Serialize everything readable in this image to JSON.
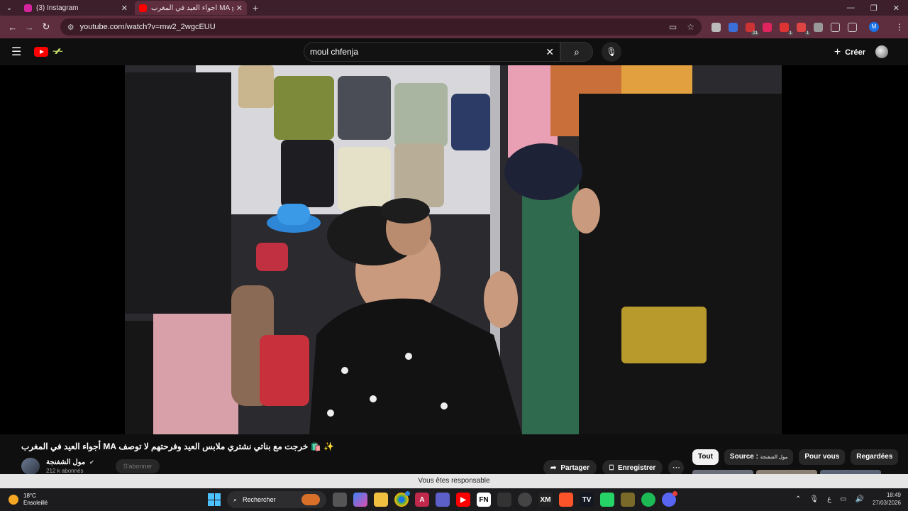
{
  "browser": {
    "tabs": [
      {
        "title": "(3) Instagram",
        "favicon_color": "#d6249f"
      },
      {
        "title": "أجواء العيد في المغرب MA خ...",
        "favicon_color": "#ff0000"
      }
    ],
    "url": "youtube.com/watch?v=mw2_2wgcEUU",
    "profile_initial": "M",
    "extension_badges": [
      "21",
      "1",
      "1"
    ]
  },
  "youtube": {
    "search_query": "moul chfenja",
    "create_label": "Créer",
    "video": {
      "title": "✨ 🛍️ خرجت مع بناتي نشتري ملابس العيد وفرحتهم لا توصف MA أجواء العيد في المغرب",
      "channel_name": "مول الشفنجة",
      "subscribers": "212 k abonnés",
      "subscribe_label": "S'abonner",
      "share_label": "Partager",
      "save_label": "Enregistrer"
    },
    "chips": [
      {
        "label": "Tout",
        "active": true
      },
      {
        "label": "Source : ",
        "suffix": "مول الشفنجة",
        "active": false
      },
      {
        "label": "Pour vous",
        "active": false
      },
      {
        "label": "Regardées",
        "active": false
      }
    ],
    "toast": "Vous êtes responsable"
  },
  "taskbar": {
    "weather_temp": "18°C",
    "weather_desc": "Ensoleillé",
    "search_label": "Rechercher",
    "language": "ع",
    "time": "18:49",
    "date": "27/03/2026"
  }
}
